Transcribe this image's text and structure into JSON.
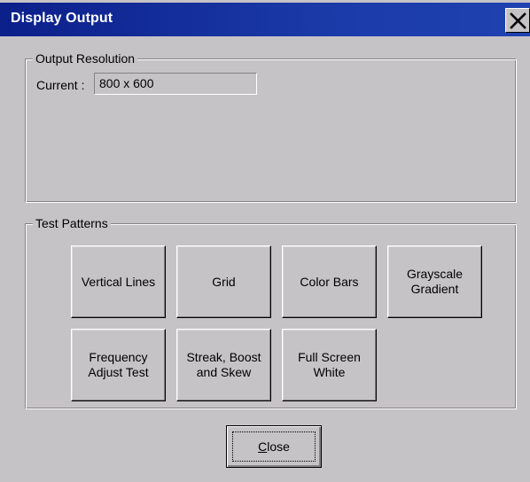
{
  "window": {
    "title": "Display Output"
  },
  "output_resolution": {
    "legend": "Output Resolution",
    "current_label": "Current :",
    "current_value": "800 x 600"
  },
  "test_patterns": {
    "legend": "Test Patterns",
    "buttons": [
      {
        "label": "Vertical Lines"
      },
      {
        "label": "Grid"
      },
      {
        "label": "Color Bars"
      },
      {
        "label": "Grayscale\nGradient"
      },
      {
        "label": "Frequency\nAdjust Test"
      },
      {
        "label": "Streak, Boost\nand Skew"
      },
      {
        "label": "Full Screen\nWhite"
      }
    ]
  },
  "footer": {
    "close_mnemonic": "C",
    "close_rest": "lose"
  },
  "colors": {
    "titlebar": "#10208c",
    "face": "#c6c3c6"
  },
  "icons": {
    "title_close": "close-x-icon"
  }
}
